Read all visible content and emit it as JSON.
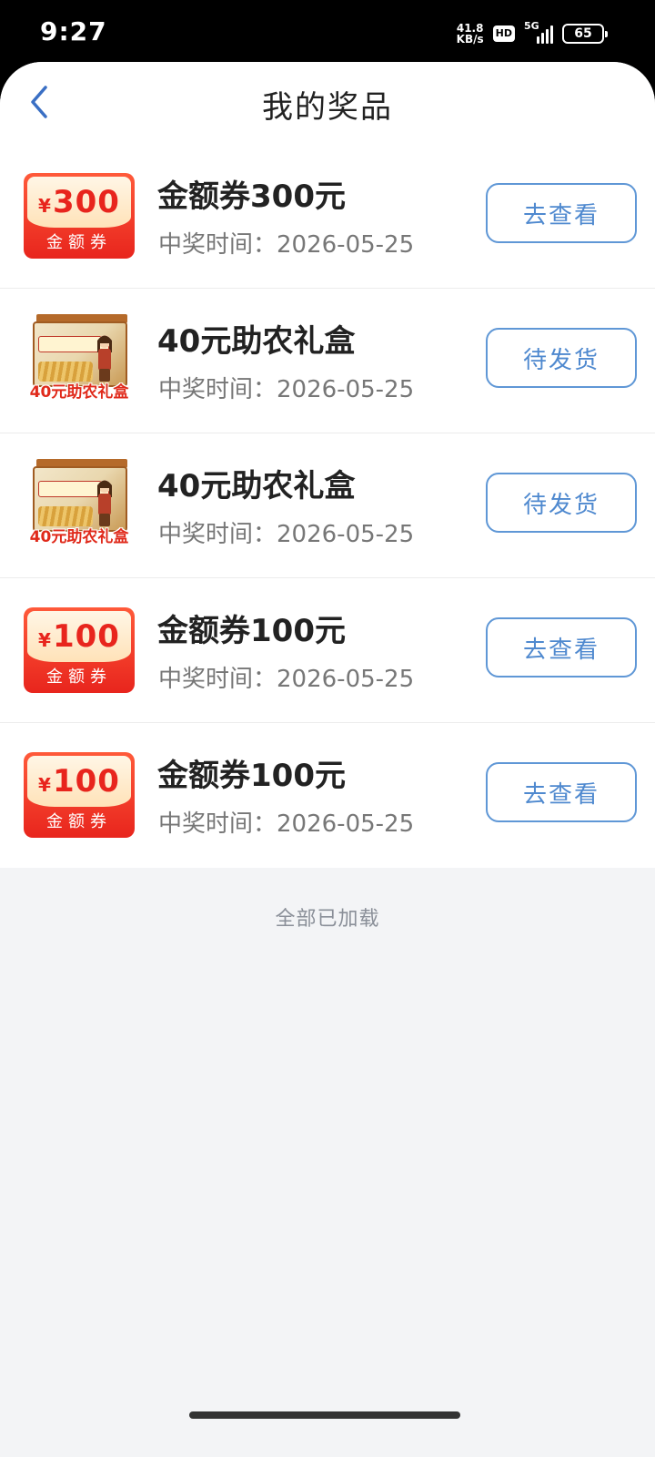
{
  "status_bar": {
    "time": "9:27",
    "net_speed_value": "41.8",
    "net_speed_unit": "KB/s",
    "hd": "HD",
    "network": "5G",
    "battery": "65"
  },
  "header": {
    "title": "我的奖品",
    "back_icon": "chevron-left-icon"
  },
  "prizes": [
    {
      "type": "coupon",
      "thumb_currency": "¥",
      "thumb_amount": "300",
      "thumb_label": "金额券",
      "title": "金额券300元",
      "time_label": "中奖时间：",
      "time": "2026-05-25",
      "action": "去查看"
    },
    {
      "type": "giftbox",
      "thumb_caption": "40元助农礼盒",
      "title": "40元助农礼盒",
      "time_label": "中奖时间：",
      "time": "2026-05-25",
      "action": "待发货"
    },
    {
      "type": "giftbox",
      "thumb_caption": "40元助农礼盒",
      "title": "40元助农礼盒",
      "time_label": "中奖时间：",
      "time": "2026-05-25",
      "action": "待发货"
    },
    {
      "type": "coupon",
      "thumb_currency": "¥",
      "thumb_amount": "100",
      "thumb_label": "金额券",
      "title": "金额券100元",
      "time_label": "中奖时间：",
      "time": "2026-05-25",
      "action": "去查看"
    },
    {
      "type": "coupon",
      "thumb_currency": "¥",
      "thumb_amount": "100",
      "thumb_label": "金额券",
      "title": "金额券100元",
      "time_label": "中奖时间：",
      "time": "2026-05-25",
      "action": "去查看"
    }
  ],
  "footer": {
    "note": "全部已加载"
  },
  "colors": {
    "accent": "#4f89cf",
    "coupon_red": "#e8251d",
    "background": "#f3f4f6"
  }
}
